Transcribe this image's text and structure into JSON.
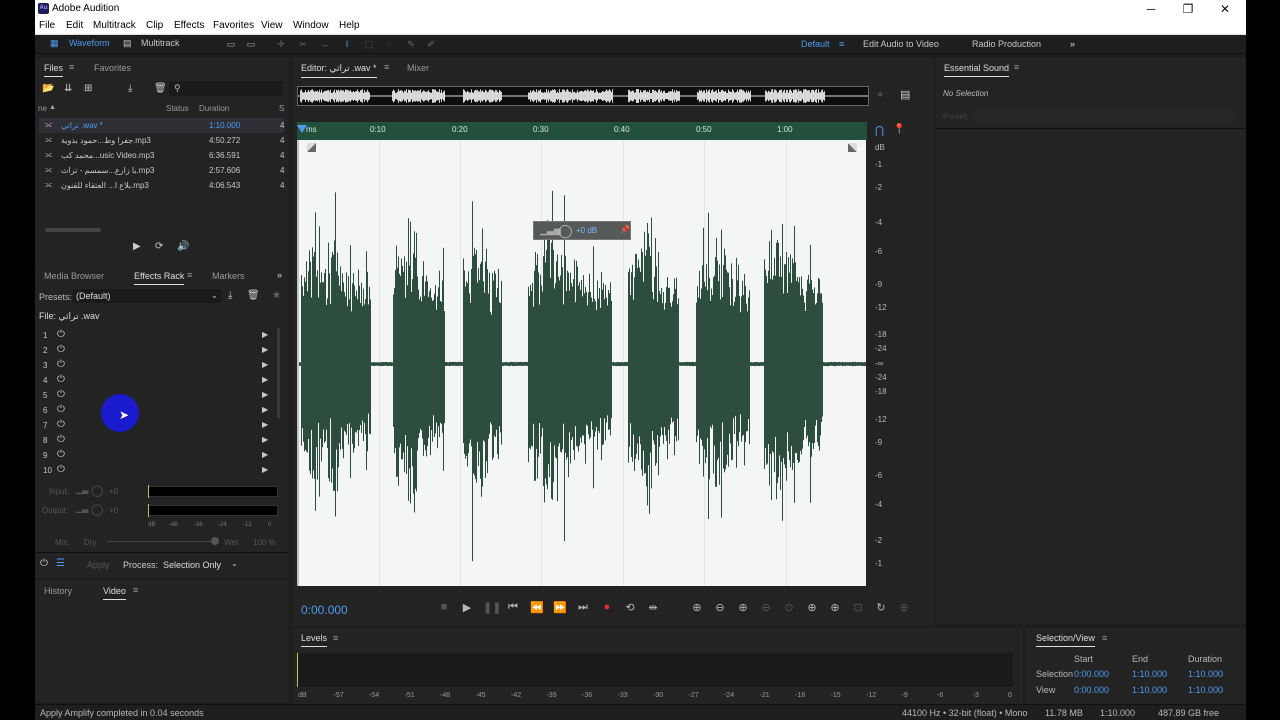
{
  "titlebar": {
    "app_title": "Adobe Audition",
    "logo": "Au"
  },
  "menu": [
    "File",
    "Edit",
    "Multitrack",
    "Clip",
    "Effects",
    "Favorites",
    "View",
    "Window",
    "Help"
  ],
  "toolbar": {
    "waveform": "Waveform",
    "multitrack": "Multitrack",
    "workspaces": [
      "Default",
      "Edit Audio to Video",
      "Radio Production"
    ]
  },
  "files_panel": {
    "tabs": [
      "Files",
      "Favorites"
    ],
    "headers": {
      "name": "ne",
      "status": "Status",
      "duration": "Duration",
      "s": "S"
    },
    "rows": [
      {
        "name": "تراثي .wav *",
        "duration": "1:10.000",
        "s": "4",
        "selected": true
      },
      {
        "name": "جفرا وط...حمود بدوية.mp3",
        "duration": "4:50.272",
        "s": "4"
      },
      {
        "name": "محمد كب...usic Video.mp3",
        "duration": "6:36.591",
        "s": "4"
      },
      {
        "name": "يا زارع...سمسم - تراث.mp3",
        "duration": "2:57.606",
        "s": "4"
      },
      {
        "name": "بلاع ا... العتقاء للفنون.mp3",
        "duration": "4:06.543",
        "s": "4"
      }
    ]
  },
  "effects_panel": {
    "tabs": [
      "Media Browser",
      "Effects Rack",
      "Markers"
    ],
    "presets_label": "Presets:",
    "presets_value": "(Default)",
    "file_label": "File: تراثي .wav",
    "slots": [
      "1",
      "2",
      "3",
      "4",
      "5",
      "6",
      "7",
      "8",
      "9",
      "10"
    ],
    "input_label": "Input:",
    "input_value": "+0",
    "output_label": "Output:",
    "output_value": "+0",
    "meter_ticks": [
      "dB",
      "-48",
      "-36",
      "-24",
      "-12",
      "0"
    ],
    "mix_label": "Mix:",
    "dry_label": "Dry",
    "wet_label": "Wet",
    "wet_value": "100 %",
    "apply_label": "Apply",
    "process_label": "Process:",
    "process_value": "Selection Only"
  },
  "history_panel": {
    "tabs": [
      "History",
      "Video"
    ]
  },
  "editor": {
    "tabs": [
      "Editor: تراثي .wav *",
      "Mixer"
    ],
    "time_labels": [
      "ms",
      "0:10",
      "0:20",
      "0:30",
      "0:40",
      "0:50",
      "1:00"
    ],
    "db_labels": [
      "dB",
      "-1",
      "-2",
      "-4",
      "-6",
      "-9",
      "-12",
      "-18",
      "-24",
      "-∞",
      "-24",
      "-18",
      "-12",
      "-9",
      "-6",
      "-4",
      "-2",
      "-1"
    ],
    "hud_value": "+0 dB",
    "current_time": "0:00.000"
  },
  "levels_panel": {
    "title": "Levels",
    "ticks": [
      "dB",
      "-57",
      "-54",
      "-51",
      "-48",
      "-45",
      "-42",
      "-39",
      "-36",
      "-33",
      "-30",
      "-27",
      "-24",
      "-21",
      "-18",
      "-15",
      "-12",
      "-9",
      "-6",
      "-3",
      "0"
    ]
  },
  "selection_view": {
    "title": "Selection/View",
    "headers": [
      "Start",
      "End",
      "Duration"
    ],
    "rows": [
      {
        "label": "Selection",
        "start": "0:00.000",
        "end": "1:10.000",
        "duration": "1:10.000"
      },
      {
        "label": "View",
        "start": "0:00.000",
        "end": "1:10.000",
        "duration": "1:10.000"
      }
    ]
  },
  "essential_sound": {
    "title": "Essential Sound",
    "no_selection": "No Selection",
    "preset_label": "Preset:"
  },
  "status_bar": {
    "message": "Apply Amplify completed in 0.04 seconds",
    "format": "44100 Hz • 32-bit (float) • Mono",
    "size": "11.78 MB",
    "duration": "1:10.000",
    "free": "487.89 GB free"
  },
  "colors": {
    "accent": "#4d9cf0",
    "waveform": "#2d4d3f",
    "timeline": "#23503d",
    "record": "#e03030"
  },
  "waveform_bursts": [
    [
      0.2,
      8.8
    ],
    [
      11.5,
      18.0
    ],
    [
      20.2,
      25.0
    ],
    [
      28.2,
      38.6
    ],
    [
      40.5,
      46.8
    ],
    [
      48.9,
      55.6
    ],
    [
      57.3,
      64.6
    ]
  ]
}
